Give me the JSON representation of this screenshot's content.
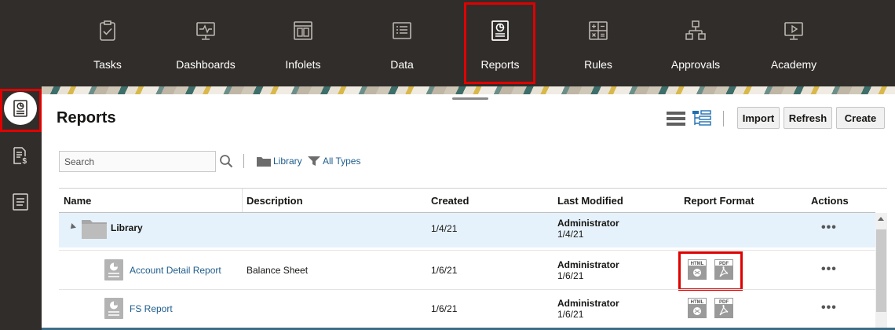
{
  "nav": {
    "items": [
      {
        "label": "Tasks",
        "icon": "tasks-icon"
      },
      {
        "label": "Dashboards",
        "icon": "dashboards-icon"
      },
      {
        "label": "Infolets",
        "icon": "infolets-icon"
      },
      {
        "label": "Data",
        "icon": "data-icon"
      },
      {
        "label": "Reports",
        "icon": "reports-icon",
        "selected": true
      },
      {
        "label": "Rules",
        "icon": "rules-icon"
      },
      {
        "label": "Approvals",
        "icon": "approvals-icon"
      },
      {
        "label": "Academy",
        "icon": "academy-icon"
      }
    ]
  },
  "rail": {
    "items": [
      {
        "icon": "reports-icon",
        "selected": true
      },
      {
        "icon": "financial-report-icon"
      },
      {
        "icon": "document-icon"
      }
    ]
  },
  "page": {
    "title": "Reports"
  },
  "toolbar": {
    "import_label": "Import",
    "refresh_label": "Refresh",
    "create_label": "Create"
  },
  "filters": {
    "search_placeholder": "Search",
    "library_label": "Library",
    "types_label": "All Types"
  },
  "table": {
    "columns": [
      "Name",
      "Description",
      "Created",
      "Last Modified",
      "Report Format",
      "Actions"
    ],
    "rows": [
      {
        "name": "Library",
        "type": "folder",
        "description": "",
        "created": "1/4/21",
        "modified_by": "Administrator",
        "modified_date": "1/4/21",
        "formats": [],
        "actions": "•••"
      },
      {
        "name": "Account Detail Report",
        "type": "report",
        "description": "Balance Sheet",
        "created": "1/6/21",
        "modified_by": "Administrator",
        "modified_date": "1/6/21",
        "formats": [
          "HTML",
          "PDF"
        ],
        "actions": "•••"
      },
      {
        "name": "FS Report",
        "type": "report",
        "description": "",
        "created": "1/6/21",
        "modified_by": "Administrator",
        "modified_date": "1/6/21",
        "formats": [
          "HTML",
          "PDF"
        ],
        "actions": "•••"
      }
    ]
  },
  "colors": {
    "topbar": "#312d2a",
    "link": "#1e5d8c",
    "highlight": "#e00000",
    "row_selected": "#e6f2fb"
  }
}
